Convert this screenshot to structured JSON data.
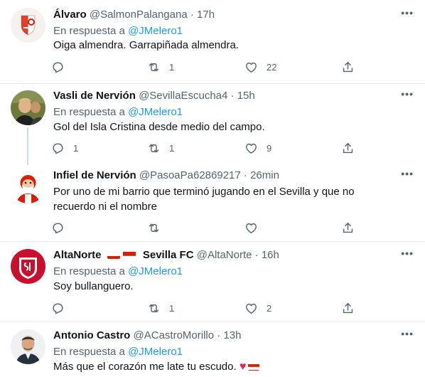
{
  "tweets": [
    {
      "name": "Álvaro",
      "handle": "@SalmonPalangana",
      "time": "17h",
      "reply_prefix": "En respuesta a",
      "reply_to": "@JMelero1",
      "text": "Oiga almendra. Garrapiñada almendra.",
      "replies": "",
      "retweets": "1",
      "likes": "22"
    },
    {
      "name": "Vasli de Nervión",
      "handle": "@SevillaEscucha4",
      "time": "15h",
      "reply_prefix": "En respuesta a",
      "reply_to": "@JMelero1",
      "text": "Gol del Isla Cristina desde medio del campo.",
      "replies": "1",
      "retweets": "1",
      "likes": "9"
    },
    {
      "name": "Infiel de Nervión",
      "handle": "@PasoaPa62869217",
      "time": "26min",
      "text": "Por uno de mi barrio que terminó jugando en el Sevilla y que no recuerdo ni el nombre",
      "replies": "",
      "retweets": "",
      "likes": ""
    },
    {
      "name_part1": "AltaNorte",
      "name_part2": "Sevilla FC",
      "handle": "@AltaNorte",
      "time": "16h",
      "reply_prefix": "En respuesta a",
      "reply_to": "@JMelero1",
      "text": "Soy bullanguero.",
      "replies": "",
      "retweets": "1",
      "likes": "2"
    },
    {
      "name": "Antonio Castro",
      "handle": "@ACastroMorillo",
      "time": "13h",
      "reply_prefix": "En respuesta a",
      "reply_to": "@JMelero1",
      "text": "Más que el corazón me late tu escudo."
    }
  ],
  "separator_dot": "·",
  "more_label": "•••",
  "heart_emoji": "♥",
  "colors": {
    "accent": "#1d9bf0",
    "muted": "#536471",
    "separator": "#ebeef0",
    "sevilla_red": "#d81e05"
  },
  "icons": [
    "reply-icon",
    "retweet-icon",
    "like-icon",
    "share-icon",
    "more-icon"
  ]
}
